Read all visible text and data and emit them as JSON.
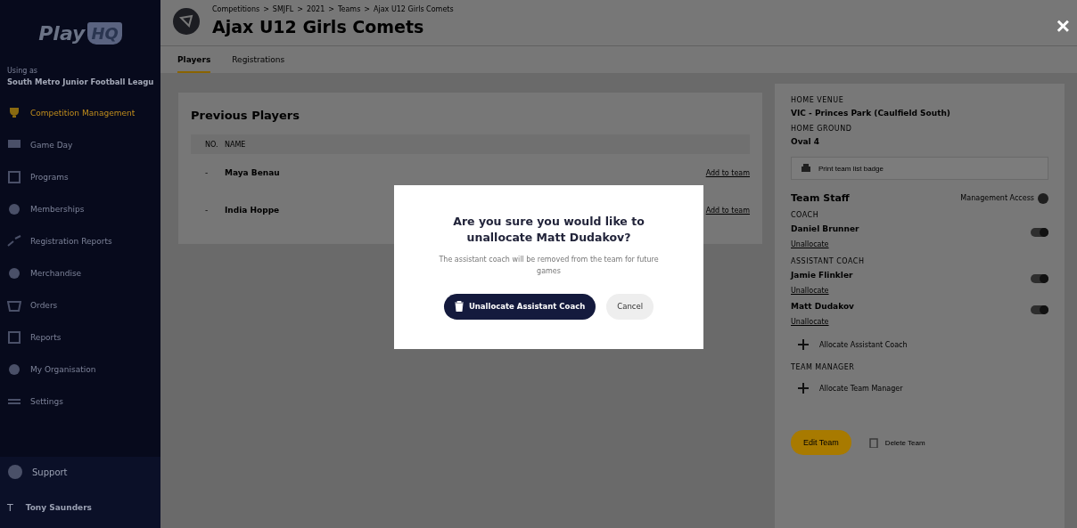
{
  "sidebar": {
    "logo": {
      "word": "Play",
      "badge": "HQ"
    },
    "org_label": "Using as",
    "org_name": "South Metro Junior Football Leagu",
    "items": [
      {
        "label": "Competition Management",
        "selected": true
      },
      {
        "label": "Game Day",
        "selected": false
      },
      {
        "label": "Programs",
        "selected": false
      },
      {
        "label": "Memberships",
        "selected": false
      },
      {
        "label": "Registration Reports",
        "selected": false
      },
      {
        "label": "Merchandise",
        "selected": false
      },
      {
        "label": "Orders",
        "selected": false
      },
      {
        "label": "Reports",
        "selected": false
      },
      {
        "label": "My Organisation",
        "selected": false
      },
      {
        "label": "Settings",
        "selected": false
      }
    ],
    "support": "Support",
    "user": {
      "initial": "T",
      "name": "Tony Saunders"
    }
  },
  "header": {
    "breadcrumb_separator": ">",
    "breadcrumb": [
      "Competitions",
      "SMJFL",
      "2021",
      "Teams",
      "Ajax U12 Girls Comets"
    ],
    "title": "Ajax U12 Girls Comets",
    "tabs": [
      {
        "label": "Players",
        "selected": true
      },
      {
        "label": "Registrations",
        "selected": false
      }
    ]
  },
  "previous_players": {
    "title": "Previous Players",
    "columns": [
      "NO.",
      "NAME"
    ],
    "rows": [
      {
        "no": "-",
        "name": "Maya Benau",
        "action": "Add to team"
      },
      {
        "no": "-",
        "name": "India Hoppe",
        "action": "Add to team"
      }
    ]
  },
  "team_info": {
    "home_venue_label": "HOME VENUE",
    "home_venue": "VIC - Princes Park (Caulfield South)",
    "home_ground_label": "HOME GROUND",
    "home_ground": "Oval 4",
    "print_button": "Print team list badge",
    "staff_title": "Team Staff",
    "access_label": "Management Access",
    "groups": [
      {
        "label": "COACH",
        "people": [
          {
            "name": "Daniel Brunner",
            "action": "Unallocate",
            "on": true
          }
        ]
      },
      {
        "label": "ASSISTANT COACH",
        "people": [
          {
            "name": "Jamie Flinkler",
            "action": "Unallocate",
            "on": true
          },
          {
            "name": "Matt Dudakov",
            "action": "Unallocate",
            "on": true
          }
        ],
        "add": "Allocate Assistant Coach"
      },
      {
        "label": "TEAM MANAGER",
        "add": "Allocate Team Manager"
      }
    ],
    "edit_button": "Edit Team",
    "delete_button": "Delete Team"
  },
  "dialog": {
    "title": "Are you sure you would like to unallocate Matt Dudakov?",
    "message": "The assistant coach will be removed from the team for future games",
    "confirm": "Unallocate Assistant Coach",
    "cancel": "Cancel",
    "close": "×"
  }
}
